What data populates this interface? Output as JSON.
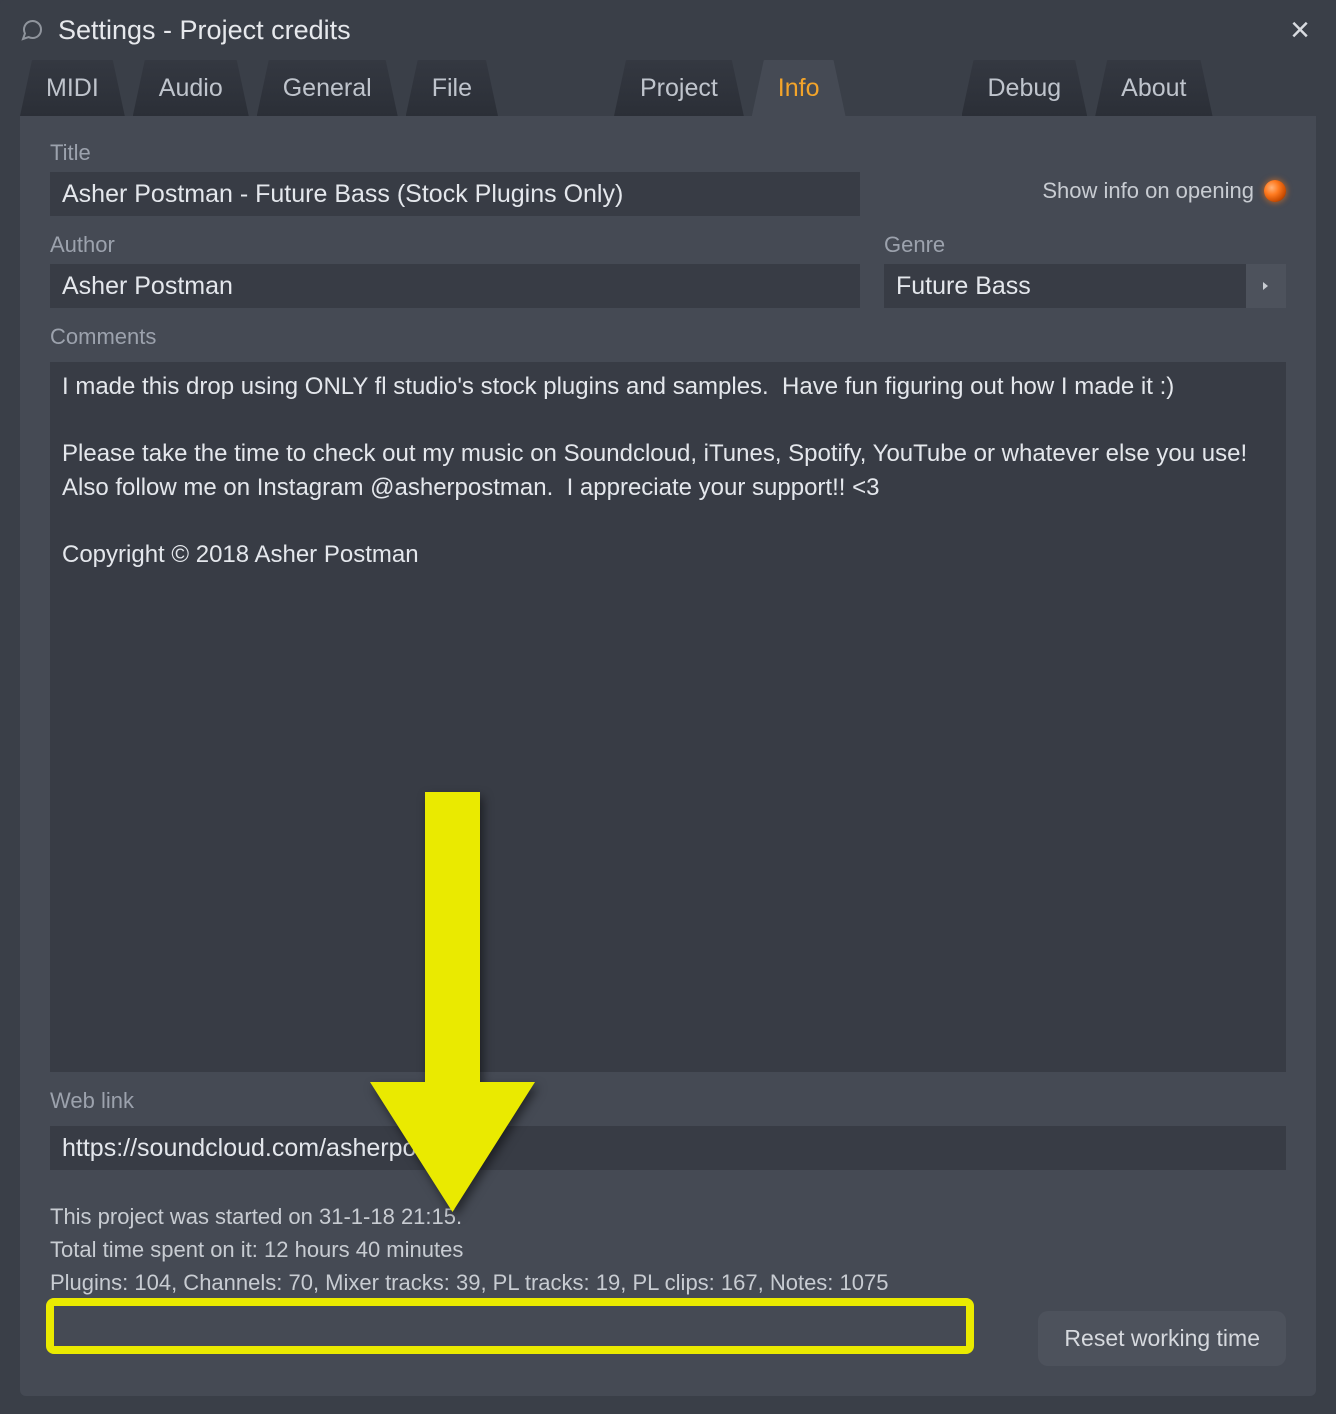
{
  "window": {
    "title": "Settings - Project credits"
  },
  "tabs": {
    "midi": "MIDI",
    "audio": "Audio",
    "general": "General",
    "file": "File",
    "project": "Project",
    "info": "Info",
    "debug": "Debug",
    "about": "About"
  },
  "labels": {
    "title": "Title",
    "author": "Author",
    "genre": "Genre",
    "comments": "Comments",
    "weblink": "Web link",
    "show_info": "Show info on opening"
  },
  "fields": {
    "title": "Asher Postman - Future Bass (Stock Plugins Only)",
    "author": "Asher Postman",
    "genre": "Future Bass",
    "comments": "I made this drop using ONLY fl studio's stock plugins and samples.  Have fun figuring out how I made it :)\n\nPlease take the time to check out my music on Soundcloud, iTunes, Spotify, YouTube or whatever else you use!  Also follow me on Instagram @asherpostman.  I appreciate your support!! <3\n\nCopyright © 2018 Asher Postman",
    "weblink": "https://soundcloud.com/asherpostman"
  },
  "footer": {
    "started": "This project was started on 31-1-18 21:15.",
    "time_spent": "Total time spent on it: 12 hours 40 minutes",
    "stats": "Plugins: 104, Channels: 70, Mixer tracks: 39, PL tracks: 19, PL clips: 167, Notes: 1075"
  },
  "buttons": {
    "reset": "Reset working time"
  }
}
